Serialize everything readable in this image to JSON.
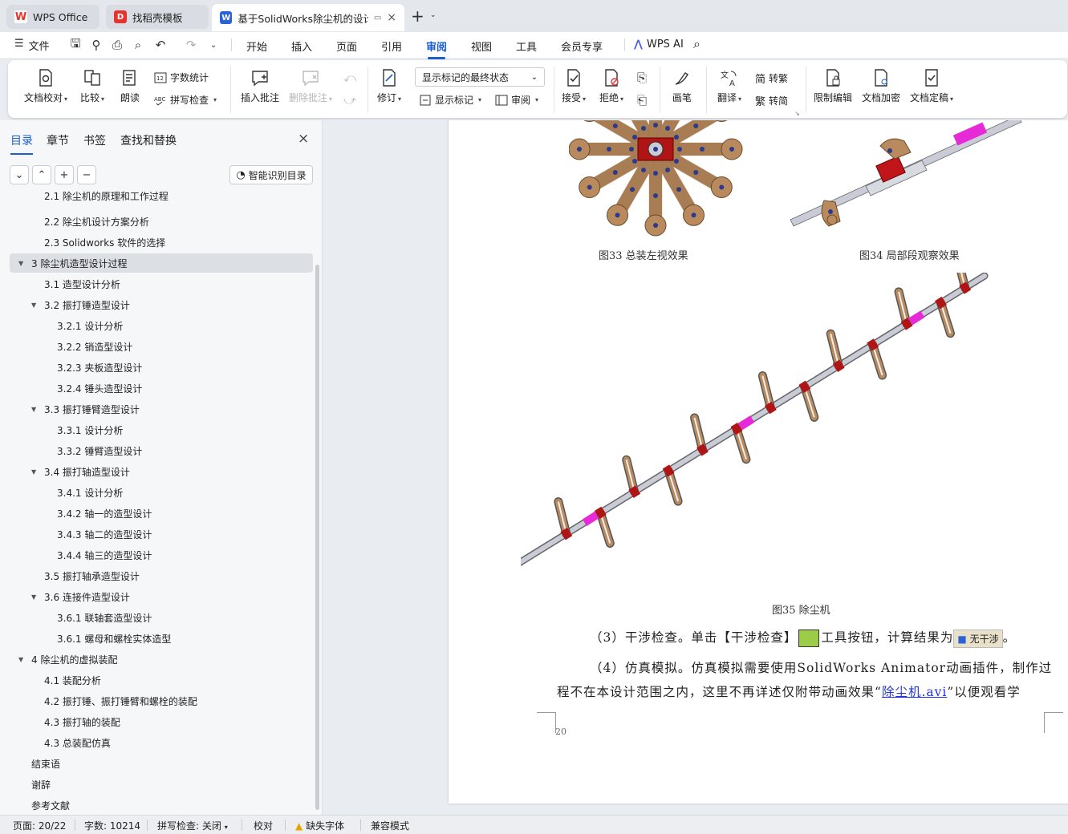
{
  "tabs": [
    {
      "label": "WPS Office",
      "icon": "wps-logo-icon"
    },
    {
      "label": "找稻壳模板",
      "icon": "docer-icon"
    },
    {
      "label": "基于SolidWorks除尘机的设计",
      "icon": "writer-doc-icon",
      "close": "×"
    }
  ],
  "new_tab": "+",
  "menu": {
    "file": "文件",
    "items": [
      "开始",
      "插入",
      "页面",
      "引用",
      "审阅",
      "视图",
      "工具",
      "会员专享"
    ],
    "active": "审阅",
    "ai": "WPS AI"
  },
  "ribbon": {
    "doc_check": "文档校对",
    "compare": "比较",
    "read_aloud": "朗读",
    "word_count": "字数统计",
    "spell_check": "拼写检查",
    "insert_comment": "插入批注",
    "delete_comment": "删除批注",
    "revise": "修订",
    "markup_state": "显示标记的最终状态",
    "show_markup": "显示标记",
    "review": "审阅",
    "accept": "接受",
    "reject": "拒绝",
    "pen": "画笔",
    "translate": "翻译",
    "to_traditional": "转繁",
    "to_simplified": "转简",
    "restrict_edit": "限制编辑",
    "encrypt": "文档加密",
    "finalize": "文档定稿"
  },
  "sidebar": {
    "tabs": [
      "目录",
      "章节",
      "书签",
      "查找和替换"
    ],
    "active_tab": "目录",
    "smart_toc": "智能识别目录",
    "toc": [
      {
        "label": "2.1  除尘机的原理和工作过程",
        "level": 2
      },
      {
        "label": "2.2  除尘机设计方案分析",
        "level": 2
      },
      {
        "label": "2.3 Solidworks 软件的选择",
        "level": 2
      },
      {
        "label": "3  除尘机造型设计过程",
        "level": 1,
        "expanded": true,
        "selected": true
      },
      {
        "label": "3.1  造型设计分析",
        "level": 2
      },
      {
        "label": "3.2  振打锤造型设计",
        "level": 2,
        "expanded": true
      },
      {
        "label": "3.2.1  设计分析",
        "level": 3
      },
      {
        "label": "3.2.2  销造型设计",
        "level": 3
      },
      {
        "label": "3.2.3  夹板造型设计",
        "level": 3
      },
      {
        "label": "3.2.4  锤头造型设计",
        "level": 3
      },
      {
        "label": "3.3  振打锤臂造型设计",
        "level": 2,
        "expanded": true
      },
      {
        "label": "3.3.1  设计分析",
        "level": 3
      },
      {
        "label": "3.3.2  锤臂造型设计",
        "level": 3
      },
      {
        "label": "3.4  振打轴造型设计",
        "level": 2,
        "expanded": true
      },
      {
        "label": "3.4.1  设计分析",
        "level": 3
      },
      {
        "label": "3.4.2  轴一的造型设计",
        "level": 3
      },
      {
        "label": "3.4.3  轴二的造型设计",
        "level": 3
      },
      {
        "label": "3.4.4  轴三的造型设计",
        "level": 3
      },
      {
        "label": "3.5  振打轴承造型设计",
        "level": 2
      },
      {
        "label": "3.6  连接件造型设计",
        "level": 2,
        "expanded": true
      },
      {
        "label": "3.6.1 联轴套造型设计",
        "level": 3
      },
      {
        "label": "3.6.1  螺母和螺栓实体造型",
        "level": 3
      },
      {
        "label": "4  除尘机的虚拟装配",
        "level": 1,
        "expanded": true
      },
      {
        "label": "4.1  装配分析",
        "level": 2
      },
      {
        "label": "4.2  振打锤、振打锤臂和螺栓的装配",
        "level": 2
      },
      {
        "label": "4.3  振打轴的装配",
        "level": 2
      },
      {
        "label": "4.3  总装配仿真",
        "level": 2
      },
      {
        "label": "结束语",
        "level": 1
      },
      {
        "label": "谢辞",
        "level": 1
      },
      {
        "label": "参考文献",
        "level": 1
      }
    ]
  },
  "document": {
    "fig33": "图33  总装左视效果",
    "fig34": "图34  局部段观察效果",
    "fig35": "图35  除尘机",
    "p3_a": "（3）干涉检查。单击【干涉检查】",
    "p3_b": "工具按钮，计算结果为",
    "p3_badge": "无干涉",
    "p3_c": "。",
    "p4_line1": "（4）仿真模拟。仿真模拟需要使用SolidWorks Animator动画插件，制作过",
    "p4_line2a": "程不在本设计范围之内，这里不再详述仅附带动画效果“",
    "p4_link": "除尘机.avi",
    "p4_line2b": "”以便观看学",
    "page_number": "20"
  },
  "status": {
    "page": "页面: 20/22",
    "words": "字数: 10214",
    "spell": "拼写检查: 关闭",
    "proof": "校对",
    "missing_font": "缺失字体",
    "compat": "兼容模式"
  },
  "colors": {
    "accent": "#1a5fd0",
    "arm": "#b98a5e",
    "hub": "#b01515",
    "shaft": "#c9ccd6",
    "coupling": "#e62ad8"
  }
}
